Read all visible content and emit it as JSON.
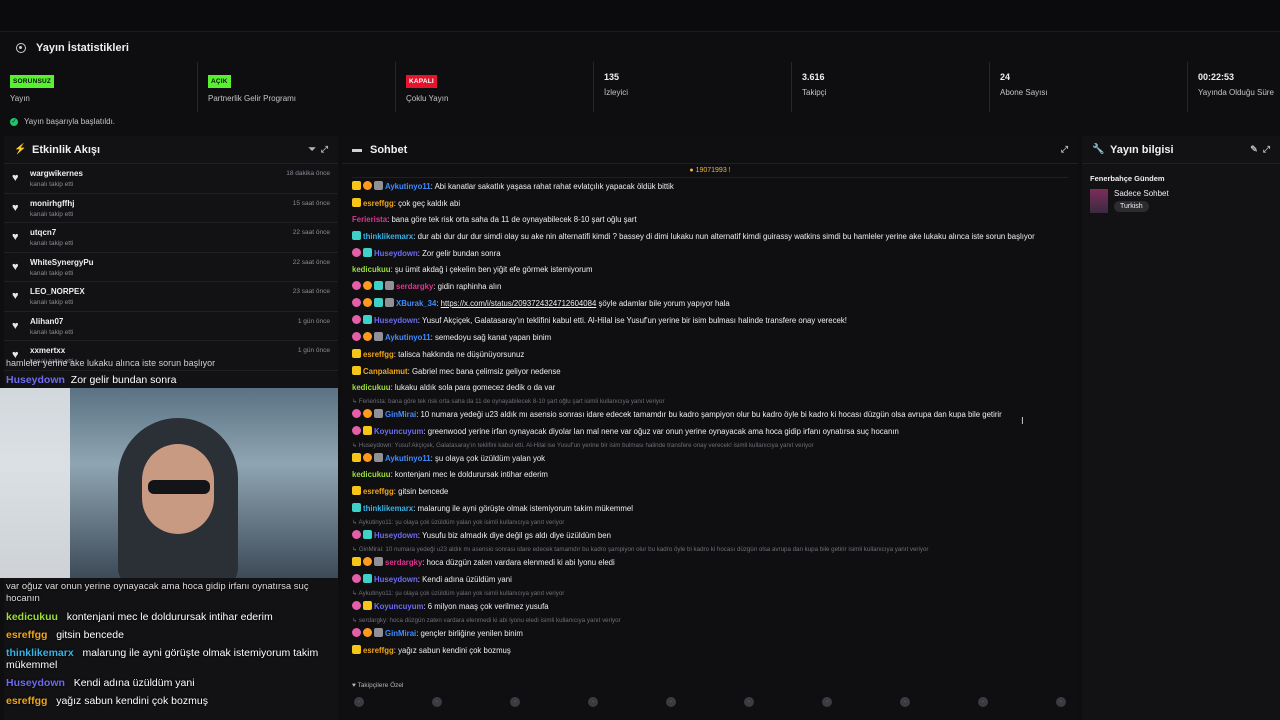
{
  "stats": {
    "title": "Yayın İstatistikleri",
    "items": [
      {
        "badge": "SORUNSUZ",
        "badge_color": "#57f12f",
        "label": "Yayın"
      },
      {
        "badge": "AÇIK",
        "badge_color": "#57f12f",
        "label": "Partnerlik Gelir Programı"
      },
      {
        "badge": "KAPALI",
        "badge_color": "#e3142c",
        "label": "Çoklu Yayın"
      },
      {
        "value": "135",
        "label": "İzleyici"
      },
      {
        "value": "3.616",
        "label": "Takipçi"
      },
      {
        "value": "24",
        "label": "Abone Sayısı"
      },
      {
        "value": "00:22:53",
        "label": "Yayında Olduğu Süre"
      }
    ],
    "status": "Yayın başarıyla başlatıldı."
  },
  "activity": {
    "title": "Etkinlik Akışı",
    "events": [
      {
        "name": "wargwikernes",
        "sub": "kanalı takip etti",
        "time": "18 dakika önce"
      },
      {
        "name": "monirhgffhj",
        "sub": "kanalı takip etti",
        "time": "15 saat önce"
      },
      {
        "name": "utqcn7",
        "sub": "kanalı takip etti",
        "time": "22 saat önce"
      },
      {
        "name": "WhiteSynergyPu",
        "sub": "kanalı takip etti",
        "time": "22 saat önce"
      },
      {
        "name": "LEO_NORPEX",
        "sub": "kanalı takip etti",
        "time": "23 saat önce"
      },
      {
        "name": "Alihan07",
        "sub": "kanalı takip etti",
        "time": "1 gün önce"
      },
      {
        "name": "xxmertxx",
        "sub": "kanalı takip etti",
        "time": "1 gün önce"
      }
    ]
  },
  "chat": {
    "title": "Sohbet",
    "pinned": "19071993",
    "footer_label": "Takipçilere Özel",
    "messages": [
      {
        "icons": "yog",
        "user": "Aykutinyo11",
        "color": "#3f8cff",
        "text": "Abi kanatlar sakatlık yaşasa rahat rahat evlatçılık yapacak öldük bittik"
      },
      {
        "icons": "y",
        "user": "esreffgg",
        "color": "#f1a516",
        "text": "çok geç kaldık abi"
      },
      {
        "icons": "",
        "user": "Ferierista",
        "color": "#e0338f",
        "text": "bana göre tek risk orta saha da 11 de oynayabilecek 8-10 şart oğlu şart"
      },
      {
        "icons": "c",
        "user": "thinklikemarx",
        "color": "#35b4e8",
        "text": "dur abi dur dur dur simdi olay su ake nin alternatifi kimdi ? bassey di dimi lukaku nun alternatif kimdi guirassy watkins simdi bu hamleler yerine ake lukaku alınca iste sorun başlıyor"
      },
      {
        "icons": "pc",
        "user": "Huseydown",
        "color": "#6d6cf0",
        "text": "Zor gelir bundan sonra"
      },
      {
        "icons": "",
        "user": "kedicukuu",
        "color": "#9cdc3b",
        "text": "şu ümit akdağ i çekelim ben yiğit efe görmek istemiyorum"
      },
      {
        "icons": "pocg",
        "user": "serdargky",
        "color": "#e0338f",
        "text": "gidin raphinha alın"
      },
      {
        "icons": "pocg",
        "user": "XBurak_34",
        "color": "#3f8cff",
        "text": "https://x.com/i/status/2093724324712604084 şöyle adamlar bile yorum yapıyor hala"
      },
      {
        "icons": "pc",
        "user": "Huseydown",
        "color": "#6d6cf0",
        "text": "Yusuf Akçiçek, Galatasaray'ın teklifini kabul etti. Al-Hilal ise Yusuf'un yerine bir isim bulması halinde transfere onay verecek!"
      },
      {
        "icons": "pog",
        "user": "Aykutinyo11",
        "color": "#3f8cff",
        "text": "semedoyu sağ kanat yapan binim"
      },
      {
        "icons": "y",
        "user": "esreffgg",
        "color": "#f1a516",
        "text": "talisca hakkında ne düşünüyorsunuz"
      },
      {
        "icons": "y",
        "user": "Canpalamut",
        "color": "#f1a516",
        "text": "Gabriel mec bana çelimsiz geliyor nedense"
      },
      {
        "icons": "",
        "user": "kedicukuu",
        "color": "#9cdc3b",
        "text": "lukaku aldık sola para gomecez dedik o da var",
        "reply_after": "Ferierista: bana göre tek risk orta saha da 11 de oynayabilecek 8-10 şart oğlu şart isimli kullanıcıya yanıt veriyor"
      },
      {
        "icons": "pog",
        "user": "GinMirai",
        "color": "#3f8cff",
        "text": "10 numara yedeği u23 aldık mı asensio sonrası idare edecek tamamdır bu kadro şampiyon olur bu kadro öyle bi kadro ki hocası düzgün olsa avrupa dan kupa bile getirir"
      },
      {
        "icons": "py",
        "user": "Koyuncuyum",
        "color": "#6d6cf0",
        "text": "greenwood yerine irfan oynayacak diyolar lan mal nene var oğuz var onun yerine oynayacak ama hoca gidip irfanı oynatırsa suç hocanın",
        "reply_after": "Huseydown: Yusuf Akçiçek, Galatasaray'ın teklifini kabul etti. Al-Hilal ise Yusuf'un yerine bir isim bulması halinde transfere onay verecek! isimli kullanıcıya yanıt veriyor"
      },
      {
        "icons": "yog",
        "user": "Aykutinyo11",
        "color": "#3f8cff",
        "text": "şu olaya çok üzüldüm yalan yok"
      },
      {
        "icons": "",
        "user": "kedicukuu",
        "color": "#9cdc3b",
        "text": "kontenjani mec le doldurursak intihar ederim"
      },
      {
        "icons": "y",
        "user": "esreffgg",
        "color": "#f1a516",
        "text": "gitsin bencede"
      },
      {
        "icons": "c",
        "user": "thinklikemarx",
        "color": "#35b4e8",
        "text": "malarung ile ayni görüşte olmak istemiyorum takim mükemmel",
        "reply_after": "Aykutinyo11: şu olaya çok üzüldüm yalan yok isimli kullanıcıya yanıt veriyor"
      },
      {
        "icons": "pc",
        "user": "Huseydown",
        "color": "#6d6cf0",
        "text": "Yusufu biz almadık diye değil gs aldı diye üzüldüm ben",
        "reply_after": "GinMirai: 10 numara yedeği u23 aldık mı asensio sonrası idare edecek tamamdır bu kadro şampiyon olur bu kadro öyle bi kadro ki hocası düzgün olsa avrupa dan kupa bile getirir isimli kullanıcıya yanıt veriyor"
      },
      {
        "icons": "yog",
        "user": "serdargky",
        "color": "#e0338f",
        "text": "hoca düzgün zaten vardara elenmedi ki abi lyonu eledi"
      },
      {
        "icons": "pc",
        "user": "Huseydown",
        "color": "#6d6cf0",
        "text": "Kendi adına üzüldüm yani",
        "reply_after": "Aykutinyo11: şu olaya çok üzüldüm yalan yok isimli kullanıcıya yanıt veriyor"
      },
      {
        "icons": "py",
        "user": "Koyuncuyum",
        "color": "#6d6cf0",
        "text": "6 milyon maaş çok verilmez yusufa",
        "reply_after": "serdargky: hoca düzgün zaten vardara elenmedi ki abi lyonu eledi isimli kullanıcıya yanıt veriyor"
      },
      {
        "icons": "pog",
        "user": "GinMirai",
        "color": "#3f8cff",
        "text": "gençler birliğine yenilen binim"
      },
      {
        "icons": "y",
        "user": "esreffgg",
        "color": "#f1a516",
        "text": "yağız sabun kendini çok bozmuş"
      }
    ],
    "emotes": [
      "·",
      "·",
      "·",
      "·",
      "·",
      "·",
      "·",
      "·",
      "·",
      "·"
    ]
  },
  "info": {
    "title": "Yayın bilgisi",
    "stream_title": "Fenerbahçe Gündem",
    "category": "Sadece Sohbet",
    "tag": "Turkish"
  },
  "overlay": {
    "top_line": "hamleler yerine ake lukaku alınca iste sorun başlıyor",
    "top_user": "Huseydown",
    "top_text": "Zor gelir bundan sonra",
    "side_fragment": "var oğuz var onun yerine oynayacak ama hoca gidip irfanı oynatırsa suç hocanın",
    "messages": [
      {
        "user": "kedicukuu",
        "color": "#9cdc3b",
        "text": "kontenjani mec le doldurursak intihar ederim"
      },
      {
        "user": "esreffgg",
        "color": "#f1a516",
        "text": "gitsin bencede"
      },
      {
        "user": "thinklikemarx",
        "color": "#35b4e8",
        "text": "malarung ile ayni görüşte olmak istemiyorum takim mükemmel"
      },
      {
        "user": "Huseydown",
        "color": "#6d6cf0",
        "text": "Kendi adına üzüldüm yani"
      },
      {
        "user": "esreffgg",
        "color": "#f1a516",
        "text": "yağız sabun kendini çok bozmuş"
      }
    ]
  }
}
